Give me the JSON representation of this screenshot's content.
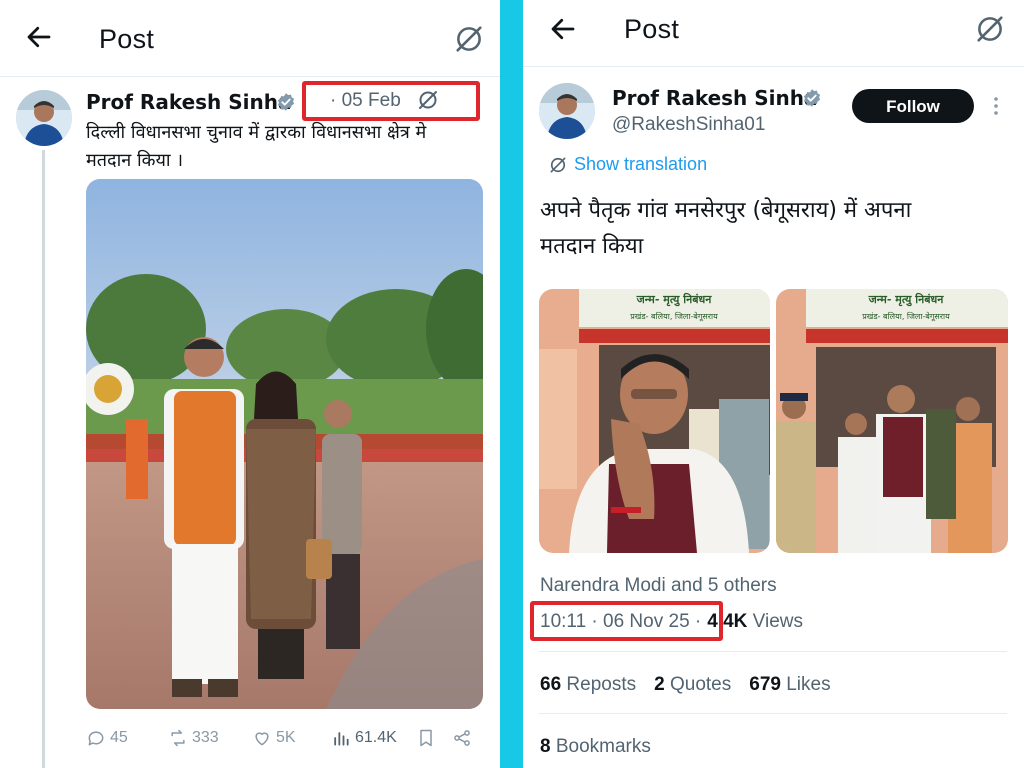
{
  "left": {
    "header": {
      "title": "Post"
    },
    "author": {
      "name": "Prof Rakesh Sinha"
    },
    "date": "· 05 Feb",
    "text_line1": "दिल्ली विधानसभा चुनाव में द्वारका  विधानसभा क्षेत्र मे",
    "text_line2": "मतदान किया ।",
    "actions": {
      "replies": "45",
      "reposts": "333",
      "likes": "5K",
      "views": "61.4K"
    }
  },
  "right": {
    "header": {
      "title": "Post"
    },
    "author": {
      "name": "Prof Rakesh Sinha",
      "handle": "@RakeshSinha01"
    },
    "follow_label": "Follow",
    "show_translation": "Show translation",
    "text_line1": "अपने पैतृक गांव मनसेरपुर (बेगूसराय) में अपना",
    "text_line2": "मतदान किया",
    "photo1_sign": "जन्म- मृत्यु निबंधन",
    "photo1_sign_sub": "प्रखंड- बलिया,   जिला-बेगूसराय",
    "photo2_sign": "जन्म- मृत्यु निबंधन",
    "photo2_sign_sub": "प्रखंड- बलिया,   जिला-बेगूसराय",
    "liked_by": "Narendra Modi and 5 others",
    "timestamp": "10:11 · 06 Nov 25 ·",
    "views_value": "4.4K",
    "views_label": " Views",
    "reposts_value": "66",
    "reposts_label": " Reposts",
    "quotes_value": "2",
    "quotes_label": " Quotes",
    "likes_value": "679",
    "likes_label": " Likes",
    "bookmarks_value": "8",
    "bookmarks_label": " Bookmarks"
  },
  "colors": {
    "background": "#17c9e6",
    "highlight": "#e0262d",
    "verified": "#829aab",
    "link": "#1d9bf0"
  },
  "icons": [
    "back-arrow-icon",
    "translate-icon",
    "verified-badge-icon",
    "reply-icon",
    "repost-icon",
    "like-icon",
    "views-icon",
    "bookmark-icon",
    "share-icon",
    "more-icon"
  ]
}
